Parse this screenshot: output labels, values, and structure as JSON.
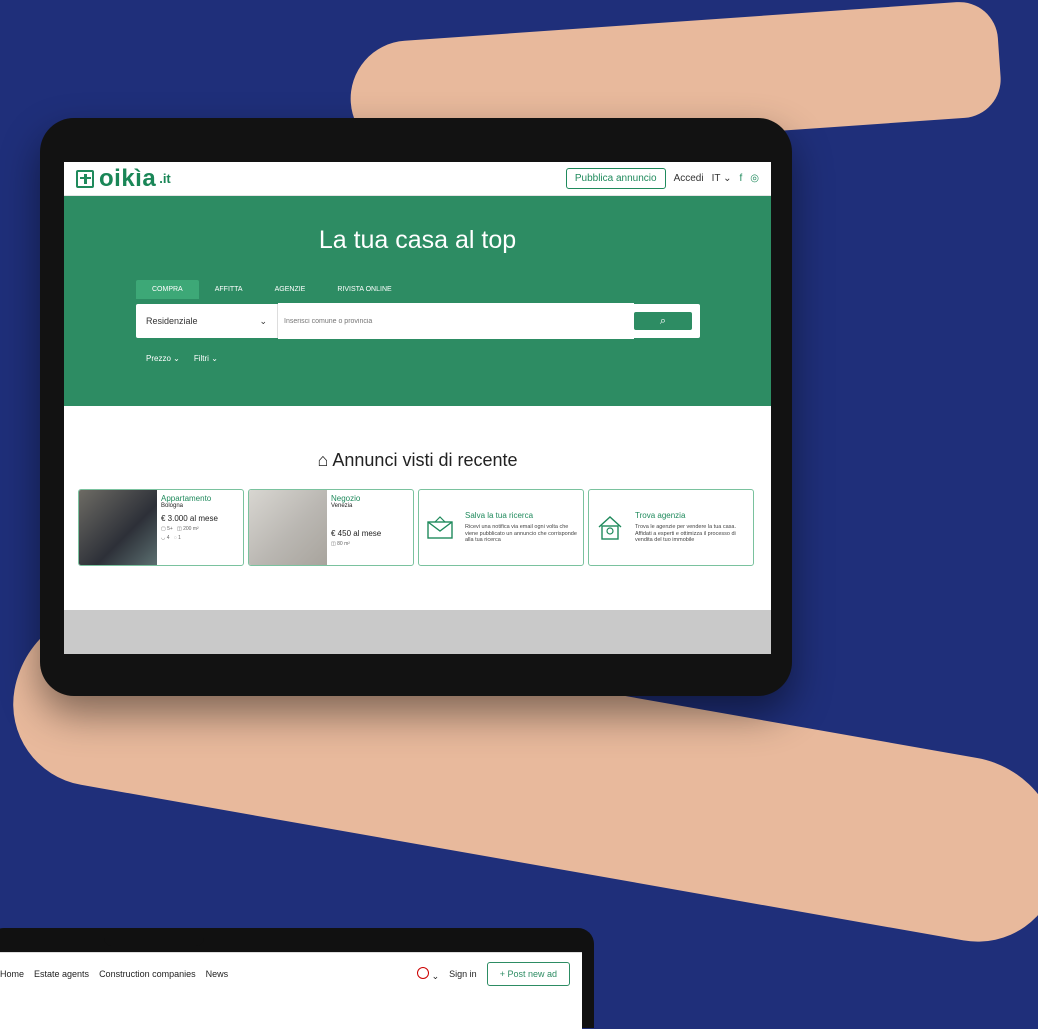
{
  "tablet": {
    "header": {
      "brand": "oikìa",
      "tld": ".it",
      "post_ad": "Pubblica annuncio",
      "login": "Accedi",
      "language": "IT"
    },
    "hero": {
      "headline": "La tua casa al top",
      "tabs": [
        {
          "label": "COMPRA"
        },
        {
          "label": "AFFITTA"
        },
        {
          "label": "AGENZIE"
        },
        {
          "label": "RIVISTA ONLINE"
        }
      ],
      "property_type": "Residenziale",
      "search_placeholder": "Inserisci comune o provincia",
      "filters": [
        "Prezzo",
        "Filtri"
      ]
    },
    "section_title": "Annunci visti di recente",
    "listings": [
      {
        "type": "Appartamento",
        "city": "Bologna",
        "price": "€ 3.000 al mese",
        "rooms": "5+",
        "area": "200 m²",
        "bath": "4",
        "floors": "1"
      },
      {
        "type": "Negozio",
        "city": "Venezia",
        "price": "€ 450 al mese",
        "area": "80 m²"
      }
    ],
    "promos": [
      {
        "title": "Salva la tua ricerca",
        "text": "Ricevi una notifica via email ogni volta che viene pubblicato un annuncio che corrisponde alla tua ricerca"
      },
      {
        "title": "Trova agenzia",
        "text": "Trova le agenzie per vendere la tua casa. Affidati a esperti e ottimizza il processo di vendita del tuo immobile"
      }
    ]
  },
  "laptop": {
    "nav": [
      "Home",
      "Estate agents",
      "Construction companies",
      "News"
    ],
    "sign_in": "Sign in",
    "post_ad": "+ Post new ad"
  }
}
